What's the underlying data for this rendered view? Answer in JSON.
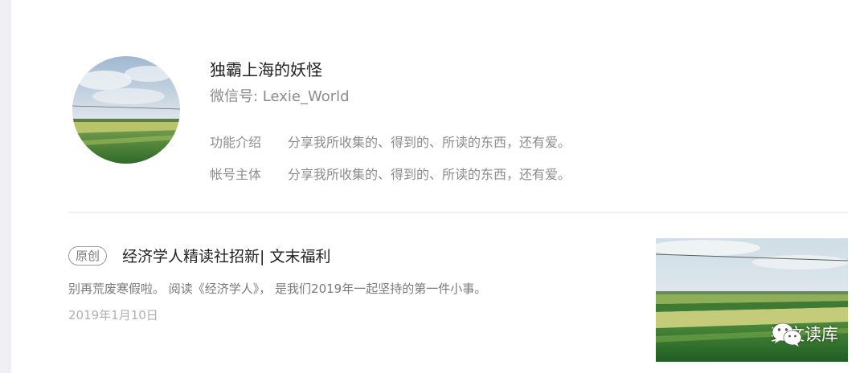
{
  "profile": {
    "account_name": "独霸上海的妖怪",
    "wechat_id": "微信号: Lexie_World",
    "function_label": "功能介绍",
    "function_text": "分享我所收集的、得到的、所读的东西，还有爱。",
    "owner_label": "帐号主体",
    "owner_text": "分享我所收集的、得到的、所读的东西，还有爱。"
  },
  "article": {
    "badge": "原创",
    "title": "经济学人精读社招新| 文末福利",
    "digest": "别再荒废寒假啦。 阅读《经济学人》， 是我们2019年一起坚持的第一件小事。",
    "date": "2019年1月10日",
    "watermark_text": "英文读库",
    "watermark_icon": "wechat-icon"
  },
  "colors": {
    "title_text": "#222222",
    "secondary_text": "#8c8c8c",
    "date_text": "#b0b0b0",
    "divider": "#e5e5e5",
    "sidebar_bg": "#f0f0f4"
  }
}
